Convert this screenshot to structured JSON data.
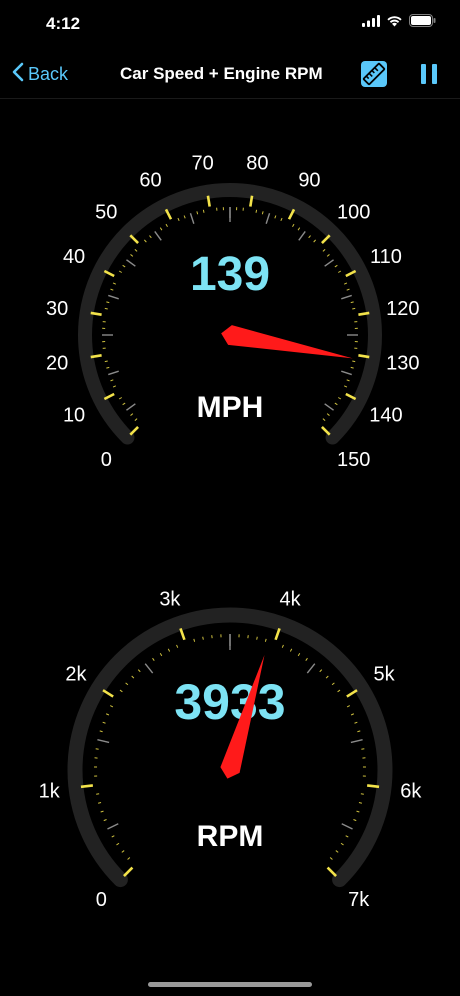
{
  "status_bar": {
    "time": "4:12",
    "icons": [
      "cellular-signal-icon",
      "wifi-icon",
      "battery-icon"
    ]
  },
  "nav": {
    "back_label": "Back",
    "title": "Car Speed + Engine RPM",
    "ruler_icon": "ruler-icon",
    "pause_icon": "pause-icon"
  },
  "colors": {
    "accent": "#5ac8fa",
    "value_color": "#7de3f4",
    "tick_major": "#f2e24a",
    "needle": "#ff1a1a",
    "track": "#222222"
  },
  "speed_gauge": {
    "value": "139",
    "unit": "MPH",
    "needle_value": 131,
    "min": 0,
    "max": 150,
    "labels": [
      "0",
      "10",
      "20",
      "30",
      "40",
      "50",
      "60",
      "70",
      "80",
      "90",
      "100",
      "110",
      "120",
      "130",
      "140",
      "150"
    ]
  },
  "rpm_gauge": {
    "value": "3933",
    "unit": "RPM",
    "needle_value": 3933,
    "min": 0,
    "max": 7000,
    "labels": [
      "0",
      "1k",
      "2k",
      "3k",
      "4k",
      "5k",
      "6k",
      "7k"
    ]
  }
}
